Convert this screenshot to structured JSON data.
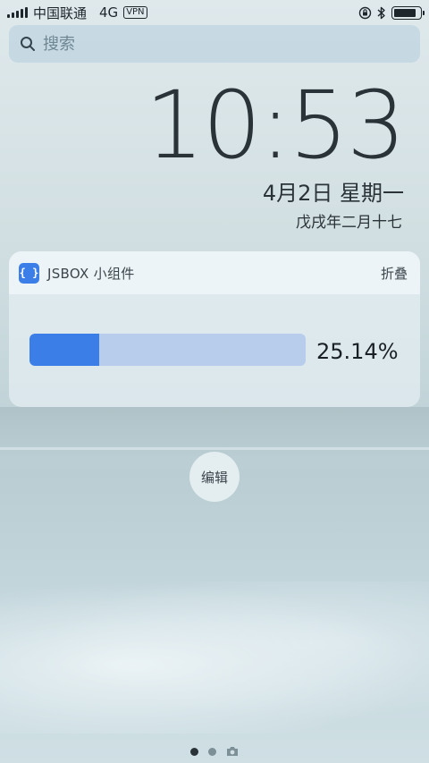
{
  "status_bar": {
    "carrier": "中国联通",
    "network": "4G",
    "vpn": "VPN",
    "battery_level": 0.85
  },
  "search": {
    "placeholder": "搜索"
  },
  "lock_screen": {
    "time": "10:53",
    "date": "4月2日 星期一",
    "lunar_date": "戊戌年二月十七"
  },
  "widget": {
    "app_icon_glyph": "{ }",
    "app_name": "JSBOX 小组件",
    "collapse_label": "折叠",
    "progress_value": 25.14,
    "progress_text": "25.14%",
    "colors": {
      "accent": "#3b7ee8",
      "track": "#b8cdec"
    }
  },
  "edit_label": "编辑",
  "page_dots": {
    "count": 2,
    "active_index": 0,
    "trailing_icon": "camera-icon"
  }
}
